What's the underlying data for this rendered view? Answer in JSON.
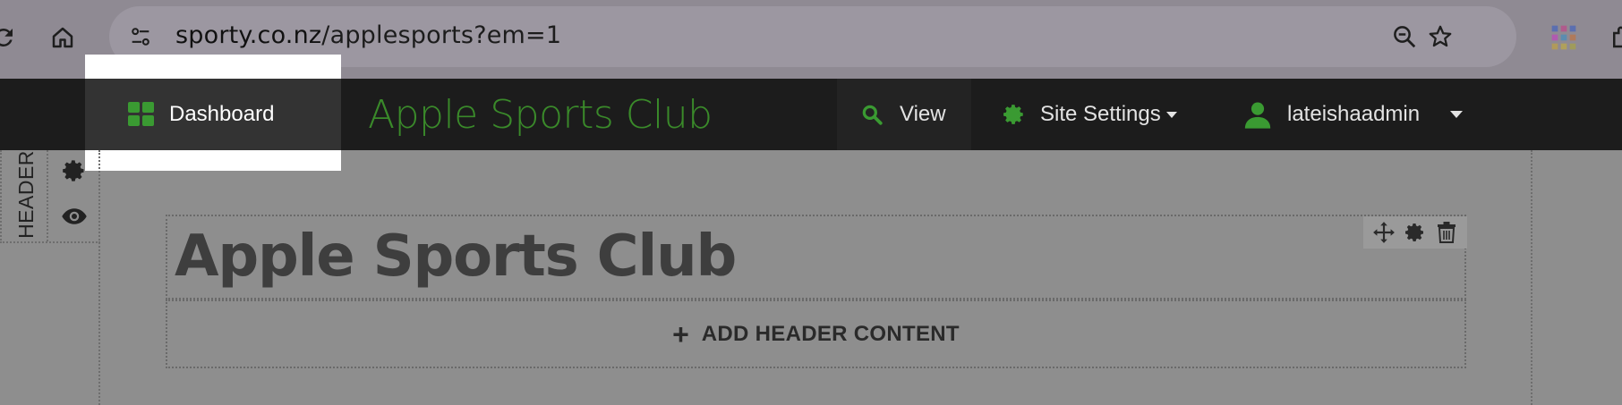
{
  "browser": {
    "url_host": "sporty.co.nz",
    "url_path": "/applesports?em=1",
    "icons": [
      "reload-icon",
      "home-icon",
      "site-info-icon",
      "zoom-out-icon",
      "bookmark-star-icon",
      "apps-grid-icon",
      "extensions-icon"
    ]
  },
  "adminbar": {
    "dashboard_label": "Dashboard",
    "site_title": "Apple Sports Club",
    "view_label": "View",
    "settings_label": "Site Settings",
    "user_label": "lateishaadmin"
  },
  "editor": {
    "header_tab_label": "HEADER",
    "block_title": "Apple Sports Club",
    "add_content_label": "ADD HEADER CONTENT",
    "add_content_icon": "+"
  },
  "colors": {
    "accent_green": "#3a8a2a",
    "adminbar_bg": "#1c1c1c",
    "chrome_bg": "#8f8a93"
  }
}
